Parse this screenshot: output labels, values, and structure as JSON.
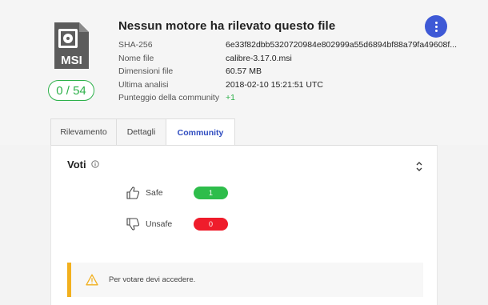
{
  "header": {
    "title": "Nessun motore ha rilevato questo file",
    "file_type_label": "MSI",
    "detection_score": "0 / 54"
  },
  "details": [
    {
      "key": "SHA-256",
      "value": "6e33f82dbb5320720984e802999a55d6894bf88a79fa49608f..."
    },
    {
      "key": "Nome file",
      "value": "calibre-3.17.0.msi"
    },
    {
      "key": "Dimensioni file",
      "value": "60.57 MB"
    },
    {
      "key": "Ultima analisi",
      "value": "2018-02-10 15:21:51 UTC"
    },
    {
      "key": "Punteggio della community",
      "value": "+1"
    }
  ],
  "tabs": [
    {
      "label": "Rilevamento",
      "active": false
    },
    {
      "label": "Dettagli",
      "active": false
    },
    {
      "label": "Community",
      "active": true
    }
  ],
  "votes_section": {
    "title": "Voti",
    "rows": [
      {
        "icon": "thumbs-up-icon",
        "label": "Safe",
        "count": "1",
        "color": "#2ebd4b"
      },
      {
        "icon": "thumbs-down-icon",
        "label": "Unsafe",
        "count": "0",
        "color": "#ef1c2b"
      }
    ]
  },
  "alert": {
    "icon": "warning-icon",
    "message": "Per votare devi accedere.",
    "accent_color": "#f2b01e"
  },
  "colors": {
    "accent": "#3e59d6",
    "clean": "#2db14a",
    "active_tab": "#2f4cc0"
  }
}
